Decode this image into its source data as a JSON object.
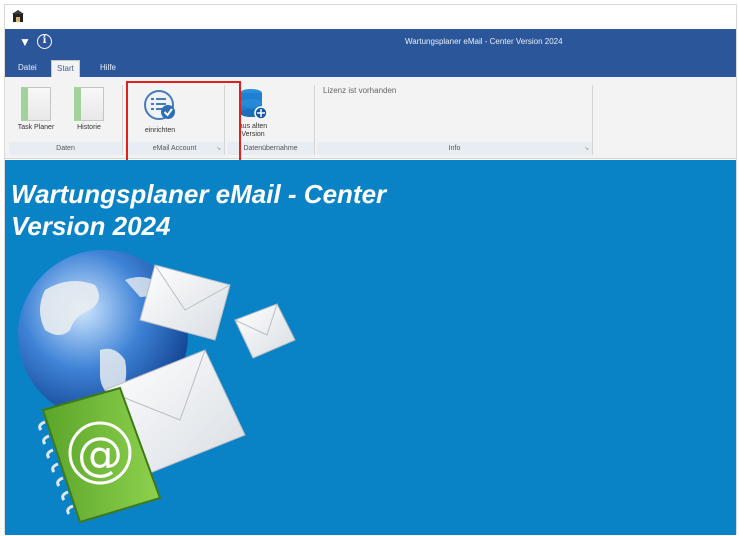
{
  "window": {
    "title": "Wartungsplaner eMail - Center Version 2024"
  },
  "quick_access": {
    "dropdown_icon": "dropdown-arrow-icon",
    "info_icon": "info-icon",
    "info_glyph": "i"
  },
  "tabs": [
    {
      "label": "Datei",
      "active": false
    },
    {
      "label": "Start",
      "active": true
    },
    {
      "label": "Hilfe",
      "active": false
    }
  ],
  "ribbon": {
    "groups": [
      {
        "label": "Daten",
        "buttons": [
          {
            "label": "Task Planer"
          },
          {
            "label": "Historie"
          }
        ]
      },
      {
        "label": "eMail Account",
        "buttons": [
          {
            "label": "einrichten"
          }
        ]
      },
      {
        "label": "Datenübernahme",
        "buttons": [
          {
            "label_line1": "aus alten",
            "label_line2": "Version"
          }
        ]
      },
      {
        "label": "Info",
        "text": "Lizenz ist vorhanden"
      }
    ]
  },
  "main": {
    "headline_line1": "Wartungsplaner eMail - Center",
    "headline_line2": "Version 2024",
    "illustration_symbol": "@"
  },
  "colors": {
    "titlebar": "#2b579a",
    "main_bg": "#0a83c6",
    "highlight": "#e01f1f"
  }
}
